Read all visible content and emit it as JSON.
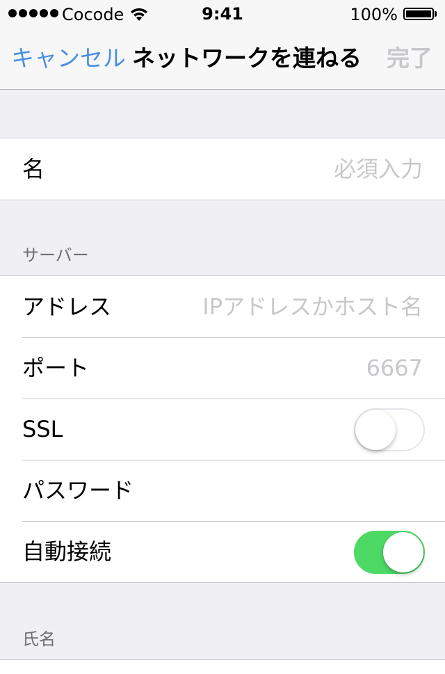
{
  "status_bar": {
    "carrier": "Cocode",
    "time": "9:41",
    "battery_percent": "100%",
    "signal_bars": 5,
    "battery_level": 1.0
  },
  "nav": {
    "cancel_label": "キャンセル",
    "title": "ネットワークを連ねる",
    "done_label": "完了"
  },
  "name_group": {
    "name_label": "名",
    "name_placeholder": "必須入力"
  },
  "server_section": {
    "header": "サーバー",
    "address_label": "アドレス",
    "address_placeholder": "IPアドレスかホスト名",
    "port_label": "ポート",
    "port_placeholder": "6667",
    "ssl_label": "SSL",
    "ssl_enabled": false,
    "password_label": "パスワード",
    "password_value": "",
    "autoconnect_label": "自動接続",
    "autoconnect_enabled": true
  },
  "identity_section": {
    "header": "氏名"
  },
  "colors": {
    "accent": "#4a90e2",
    "toggle_on": "#4cd964",
    "placeholder": "#c7c7cc",
    "grouped_background": "#efeff4"
  }
}
